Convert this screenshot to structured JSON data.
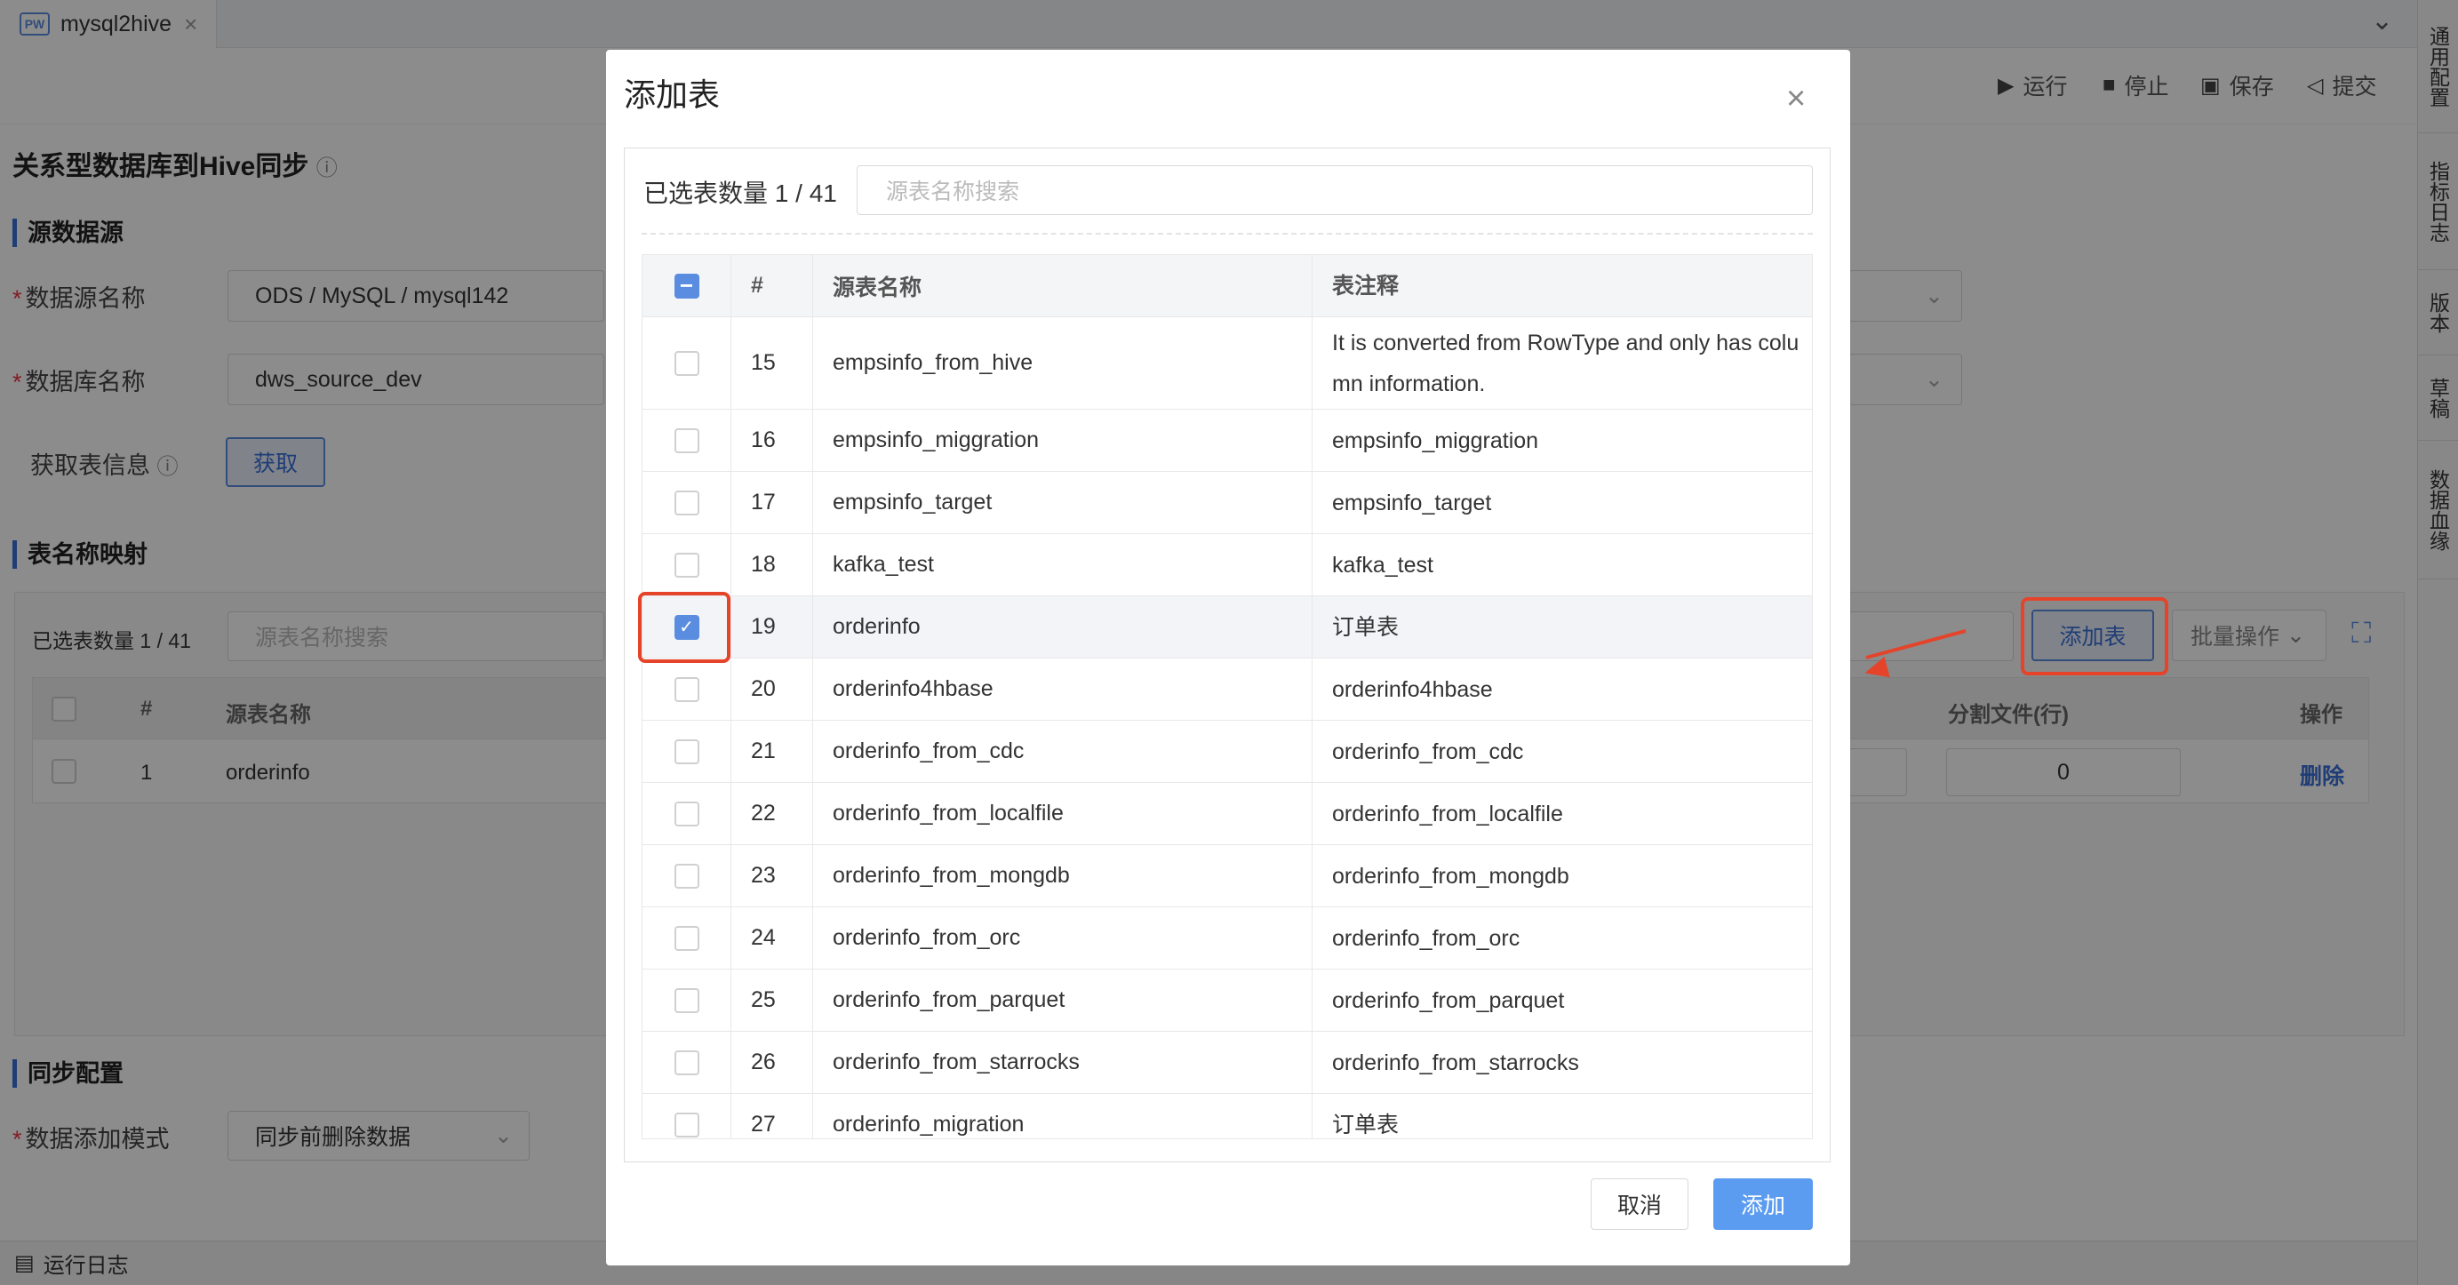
{
  "tab": {
    "title": "mysql2hive",
    "logo": "PW"
  },
  "toolbar": {
    "run": "运行",
    "stop": "停止",
    "save": "保存",
    "submit": "提交"
  },
  "right_sidebar": [
    "通用配置",
    "指标日志",
    "版本",
    "草稿",
    "数据血缘"
  ],
  "page": {
    "title": "关系型数据库到Hive同步",
    "source_section": "源数据源",
    "datasource_label": "数据源名称",
    "datasource_value": "ODS / MySQL / mysql142",
    "database_label": "数据库名称",
    "database_value": "dws_source_dev",
    "fetch_label": "获取表信息",
    "fetch_button": "获取",
    "mapping_section": "表名称映射",
    "mapping_selected": "已选表数量 1 / 41",
    "mapping_search_placeholder": "源表名称搜索",
    "add_table_button": "添加表",
    "batch_button": "批量操作",
    "mapping_columns": {
      "num": "#",
      "source": "源表名称",
      "split": "分割文件(行)",
      "op": "操作"
    },
    "mapping_row": {
      "num": "1",
      "source": "orderinfo",
      "split": "0",
      "op": "删除"
    },
    "sync_section": "同步配置",
    "add_mode_label": "数据添加模式",
    "add_mode_value": "同步前删除数据"
  },
  "footer": {
    "run_log": "运行日志"
  },
  "modal": {
    "title": "添加表",
    "selected_count": "已选表数量 1 / 41",
    "search_placeholder": "源表名称搜索",
    "columns": {
      "num": "#",
      "name": "源表名称",
      "comment": "表注释"
    },
    "rows": [
      {
        "num": "15",
        "name": "empsinfo_from_hive",
        "comment": "It is converted from RowType and only has column information.",
        "checked": false
      },
      {
        "num": "16",
        "name": "empsinfo_miggration",
        "comment": "empsinfo_miggration",
        "checked": false
      },
      {
        "num": "17",
        "name": "empsinfo_target",
        "comment": "empsinfo_target",
        "checked": false
      },
      {
        "num": "18",
        "name": "kafka_test",
        "comment": "kafka_test",
        "checked": false
      },
      {
        "num": "19",
        "name": "orderinfo",
        "comment": "订单表",
        "checked": true
      },
      {
        "num": "20",
        "name": "orderinfo4hbase",
        "comment": "orderinfo4hbase",
        "checked": false
      },
      {
        "num": "21",
        "name": "orderinfo_from_cdc",
        "comment": "orderinfo_from_cdc",
        "checked": false
      },
      {
        "num": "22",
        "name": "orderinfo_from_localfile",
        "comment": "orderinfo_from_localfile",
        "checked": false
      },
      {
        "num": "23",
        "name": "orderinfo_from_mongdb",
        "comment": "orderinfo_from_mongdb",
        "checked": false
      },
      {
        "num": "24",
        "name": "orderinfo_from_orc",
        "comment": "orderinfo_from_orc",
        "checked": false
      },
      {
        "num": "25",
        "name": "orderinfo_from_parquet",
        "comment": "orderinfo_from_parquet",
        "checked": false
      },
      {
        "num": "26",
        "name": "orderinfo_from_starrocks",
        "comment": "orderinfo_from_starrocks",
        "checked": false
      },
      {
        "num": "27",
        "name": "orderinfo_migration",
        "comment": "订单表",
        "checked": false
      }
    ],
    "cancel": "取消",
    "add": "添加"
  },
  "colors": {
    "accent": "#5a8de0",
    "primary_button": "#5b9cf0",
    "highlight_annotation": "#e5432a"
  }
}
